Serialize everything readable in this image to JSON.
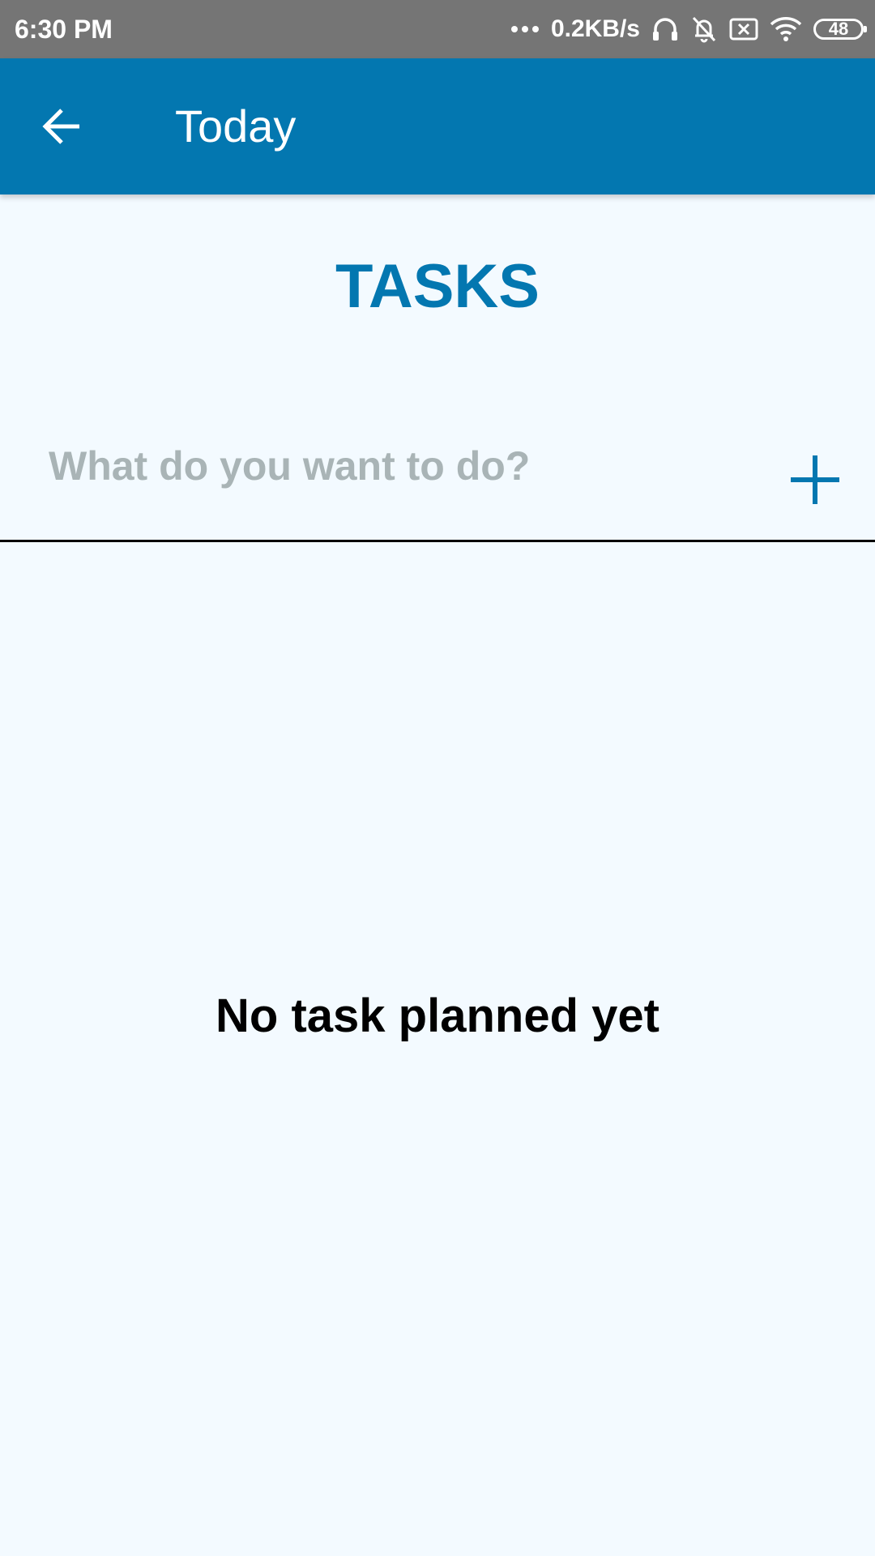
{
  "status_bar": {
    "time": "6:30 PM",
    "network_speed": "0.2KB/s",
    "battery_level": "48",
    "icons": [
      "more-dots-icon",
      "headset-icon",
      "bell-off-icon",
      "sim-blocked-icon",
      "wifi-icon",
      "battery-icon"
    ]
  },
  "app_bar": {
    "back_icon": "arrow-left-icon",
    "title": "Today"
  },
  "main": {
    "heading": "TASKS",
    "task_input": {
      "value": "",
      "placeholder": "What do you want to do?"
    },
    "add_icon": "plus-icon",
    "empty_message": "No task planned yet"
  },
  "colors": {
    "status_bar_bg": "#757575",
    "accent": "#0377B0",
    "page_bg": "#F3FAFF",
    "placeholder": "#A9B4B6"
  }
}
